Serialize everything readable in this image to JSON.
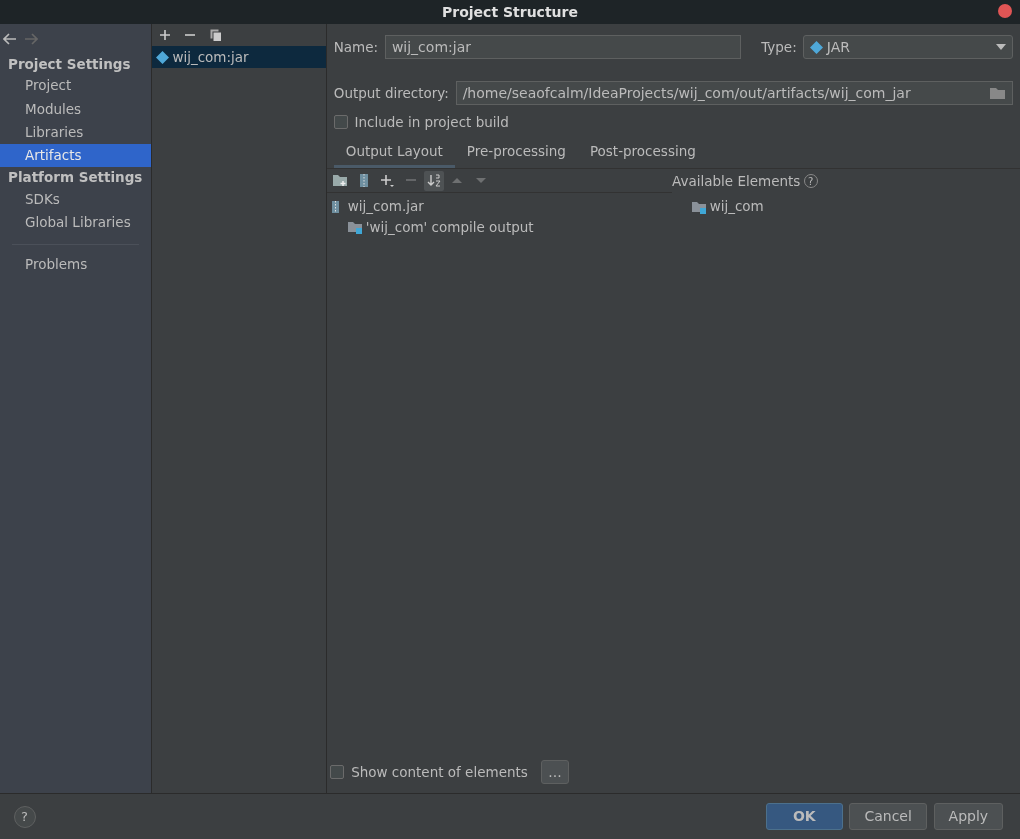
{
  "window": {
    "title": "Project Structure"
  },
  "sidebar": {
    "sections": [
      {
        "heading": "Project Settings",
        "items": [
          {
            "label": "Project",
            "selected": false
          },
          {
            "label": "Modules",
            "selected": false
          },
          {
            "label": "Libraries",
            "selected": false
          },
          {
            "label": "Artifacts",
            "selected": true
          }
        ]
      },
      {
        "heading": "Platform Settings",
        "items": [
          {
            "label": "SDKs",
            "selected": false
          },
          {
            "label": "Global Libraries",
            "selected": false
          }
        ]
      }
    ],
    "extra_items": [
      {
        "label": "Problems",
        "selected": false
      }
    ]
  },
  "artifacts": [
    {
      "label": "wij_com:jar",
      "selected": true
    }
  ],
  "form": {
    "name_label": "Name:",
    "name_value": "wij_com:jar",
    "type_label": "Type:",
    "type_value": "JAR",
    "output_label": "Output directory:",
    "output_value": "/home/seaofcalm/IdeaProjects/wij_com/out/artifacts/wij_com_jar",
    "include": {
      "label": "Include in project build",
      "checked": false
    }
  },
  "tabs": [
    {
      "label": "Output Layout",
      "selected": true
    },
    {
      "label": "Pre-processing",
      "selected": false
    },
    {
      "label": "Post-processing",
      "selected": false
    }
  ],
  "toolbar": [
    {
      "kind": "new-folder",
      "disabled": false,
      "on": false
    },
    {
      "kind": "archive",
      "disabled": false,
      "on": false
    },
    {
      "kind": "add",
      "disabled": false,
      "on": false
    },
    {
      "kind": "remove",
      "disabled": true,
      "on": false
    },
    {
      "kind": "sort",
      "disabled": false,
      "on": true
    },
    {
      "kind": "up",
      "disabled": true,
      "on": false
    },
    {
      "kind": "down",
      "disabled": true,
      "on": false
    }
  ],
  "layout_tree": [
    {
      "label": "wij_com.jar",
      "kind": "jar",
      "children": [
        {
          "label": "'wij_com' compile output",
          "kind": "module-folder"
        }
      ]
    }
  ],
  "available": {
    "title": "Available Elements",
    "help": "?",
    "items": [
      {
        "label": "wij_com",
        "kind": "module-folder"
      }
    ]
  },
  "show_content": {
    "label": "Show content of elements",
    "checked": false
  },
  "more_button": "...",
  "help_button": "?",
  "buttons": [
    {
      "label": "OK",
      "primary": true
    },
    {
      "label": "Cancel",
      "primary": false
    },
    {
      "label": "Apply",
      "primary": false
    }
  ]
}
